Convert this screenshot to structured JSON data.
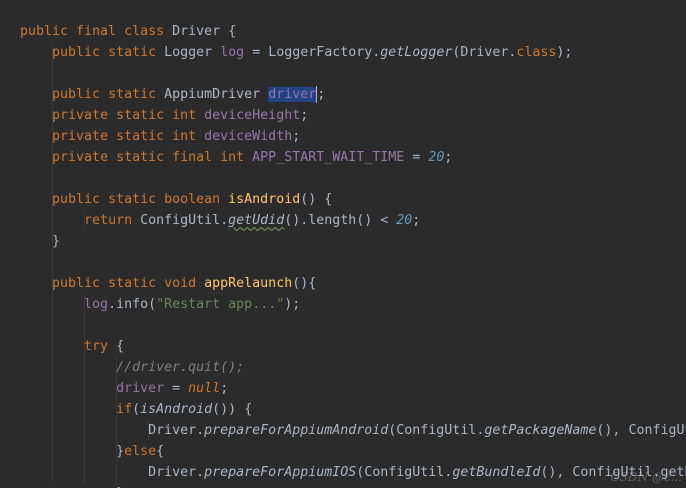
{
  "editor": {
    "lines": [
      [
        [
          "public final class ",
          "kw"
        ],
        [
          "Driver {",
          "plain"
        ]
      ],
      [
        [
          "    ",
          "plain"
        ],
        [
          "public static ",
          "kw"
        ],
        [
          "Logger ",
          "plain"
        ],
        [
          "log",
          "fld"
        ],
        [
          " = LoggerFactory.",
          "plain"
        ],
        [
          "getLogger",
          "plain ital"
        ],
        [
          "(Driver.",
          "plain"
        ],
        [
          "class",
          "kw"
        ],
        [
          ");",
          "plain"
        ]
      ],
      [],
      [
        [
          "    ",
          "plain"
        ],
        [
          "public static ",
          "kw"
        ],
        [
          "AppiumDriver ",
          "plain"
        ],
        [
          "driver",
          "fld sel"
        ],
        [
          "|caret|",
          "caret"
        ],
        [
          ";",
          "plain"
        ]
      ],
      [
        [
          "    ",
          "plain"
        ],
        [
          "private static int ",
          "kw"
        ],
        [
          "deviceHeight",
          "fld"
        ],
        [
          ";",
          "plain"
        ]
      ],
      [
        [
          "    ",
          "plain"
        ],
        [
          "private static int ",
          "kw"
        ],
        [
          "deviceWidth",
          "fld"
        ],
        [
          ";",
          "plain"
        ]
      ],
      [
        [
          "    ",
          "plain"
        ],
        [
          "private static final int ",
          "kw"
        ],
        [
          "APP_START_WAIT_TIME",
          "fld"
        ],
        [
          " = ",
          "plain"
        ],
        [
          "20",
          "num"
        ],
        [
          ";",
          "plain"
        ]
      ],
      [],
      [
        [
          "    ",
          "plain"
        ],
        [
          "public static boolean ",
          "kw"
        ],
        [
          "isAndroid",
          "meth"
        ],
        [
          "() {",
          "plain"
        ]
      ],
      [
        [
          "        ",
          "plain"
        ],
        [
          "return ",
          "kw"
        ],
        [
          "ConfigUtil.",
          "plain"
        ],
        [
          "getUdid",
          "plain ital squig"
        ],
        [
          "().length() < ",
          "plain"
        ],
        [
          "20",
          "num"
        ],
        [
          ";",
          "plain"
        ]
      ],
      [
        [
          "    }",
          "plain"
        ]
      ],
      [],
      [
        [
          "    ",
          "plain"
        ],
        [
          "public static void ",
          "kw"
        ],
        [
          "appRelaunch",
          "meth"
        ],
        [
          "(){",
          "plain"
        ]
      ],
      [
        [
          "        ",
          "plain"
        ],
        [
          "log",
          "fld"
        ],
        [
          ".info(",
          "plain"
        ],
        [
          "\"Restart app...\"",
          "str"
        ],
        [
          ");",
          "plain"
        ]
      ],
      [],
      [
        [
          "        ",
          "plain"
        ],
        [
          "try ",
          "kw"
        ],
        [
          "{",
          "plain"
        ]
      ],
      [
        [
          "            ",
          "plain"
        ],
        [
          "//driver.quit();",
          "cmt"
        ]
      ],
      [
        [
          "            ",
          "plain"
        ],
        [
          "driver",
          "fld"
        ],
        [
          " = ",
          "plain"
        ],
        [
          "null",
          "kw ital"
        ],
        [
          ";",
          "plain"
        ]
      ],
      [
        [
          "            ",
          "plain"
        ],
        [
          "if",
          "kw"
        ],
        [
          "(",
          "plain"
        ],
        [
          "isAndroid",
          "plain ital"
        ],
        [
          "()) {",
          "plain"
        ]
      ],
      [
        [
          "                ",
          "plain"
        ],
        [
          "Driver.",
          "plain"
        ],
        [
          "prepareForAppiumAndroid",
          "plain ital"
        ],
        [
          "(ConfigUtil.",
          "plain"
        ],
        [
          "getPackageName",
          "plain ital"
        ],
        [
          "(), ConfigUt",
          "plain"
        ]
      ],
      [
        [
          "            }",
          "plain"
        ],
        [
          "else",
          "kw"
        ],
        [
          "{",
          "plain"
        ]
      ],
      [
        [
          "                ",
          "plain"
        ],
        [
          "Driver.",
          "plain"
        ],
        [
          "prepareForAppiumIOS",
          "plain ital"
        ],
        [
          "(ConfigUtil.",
          "plain"
        ],
        [
          "getBundleId",
          "plain ital"
        ],
        [
          "(), ConfigUtil.getB",
          "plain"
        ]
      ],
      [
        [
          "            }",
          "plain"
        ]
      ]
    ]
  },
  "watermark": "CSDN @c..."
}
